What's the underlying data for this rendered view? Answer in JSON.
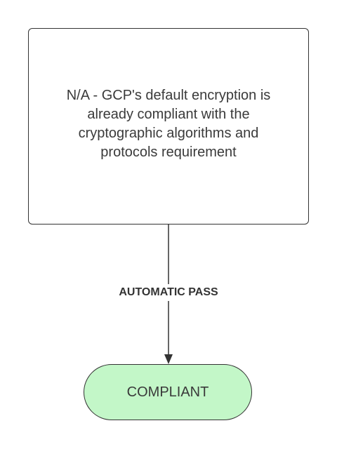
{
  "diagram": {
    "process_box": {
      "text": "N/A - GCP's default encryption is already compliant with the cryptographic algorithms and protocols requirement"
    },
    "edge": {
      "label": "AUTOMATIC PASS"
    },
    "terminal": {
      "text": "COMPLIANT",
      "fill_color": "#c3f7c8"
    },
    "colors": {
      "stroke": "#333333",
      "text": "#3a3a3a"
    }
  }
}
